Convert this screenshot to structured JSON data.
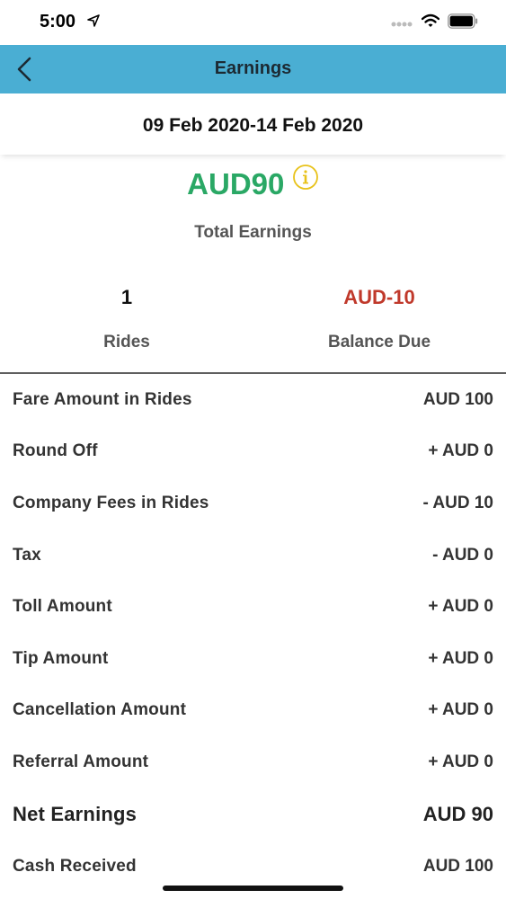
{
  "status_bar": {
    "time": "5:00"
  },
  "nav": {
    "title": "Earnings"
  },
  "date_range": "09 Feb 2020-14 Feb 2020",
  "summary": {
    "total_amount": "AUD90",
    "total_label": "Total Earnings",
    "rides_value": "1",
    "rides_label": "Rides",
    "balance_value": "AUD-10",
    "balance_label": "Balance Due"
  },
  "breakdown": [
    {
      "label": "Fare Amount in Rides",
      "value": "AUD 100"
    },
    {
      "label": "Round Off",
      "value": "+ AUD 0"
    },
    {
      "label": "Company Fees in Rides",
      "value": "- AUD 10"
    },
    {
      "label": "Tax",
      "value": "- AUD 0"
    },
    {
      "label": "Toll Amount",
      "value": "+ AUD 0"
    },
    {
      "label": "Tip Amount",
      "value": "+ AUD 0"
    },
    {
      "label": "Cancellation Amount",
      "value": "+ AUD 0"
    },
    {
      "label": "Referral Amount",
      "value": "+ AUD 0"
    }
  ],
  "net": {
    "label": "Net Earnings",
    "value": "AUD 90"
  },
  "partial_row": {
    "label": "Cash Received",
    "value": "AUD 100"
  },
  "colors": {
    "nav_bg": "#4aaed3",
    "positive": "#2aa865",
    "negative": "#c0392b",
    "info_icon": "#e8c21a"
  }
}
